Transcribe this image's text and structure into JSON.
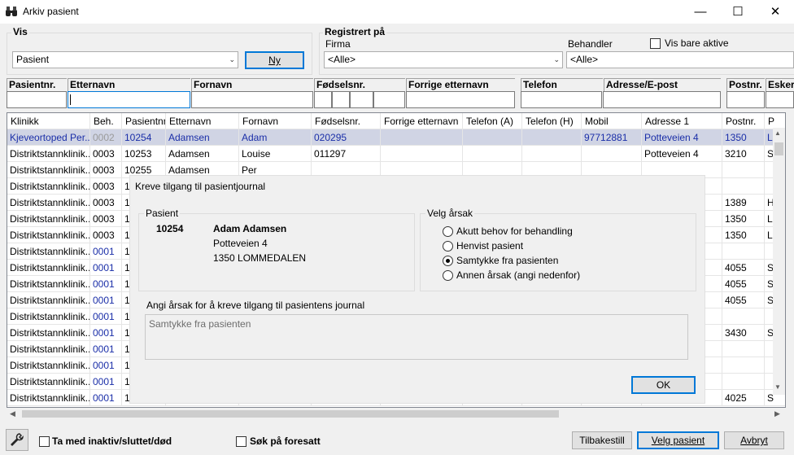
{
  "window": {
    "title": "Arkiv pasient",
    "minimize_icon": "minimize-icon",
    "maximize_icon": "maximize-icon",
    "close_icon": "close-icon"
  },
  "vis": {
    "label": "Vis",
    "selected": "Pasient",
    "ny_button": "Ny"
  },
  "registrert": {
    "label": "Registrert på",
    "firma_label": "Firma",
    "firma_selected": "<Alle>",
    "behandler_label": "Behandler",
    "behandler_selected": "<Alle>",
    "vis_bare_aktive": "Vis bare aktive"
  },
  "filters": {
    "pasientnr": "Pasientnr.",
    "etternavn": "Etternavn",
    "fornavn": "Fornavn",
    "fodselsnr": "Fødselsnr.",
    "forrige_etternavn": "Forrige etternavn",
    "telefon": "Telefon",
    "adresse": "Adresse/E-post",
    "postnr": "Postnr.",
    "esker": "Esker"
  },
  "grid": {
    "columns": [
      "Klinikk",
      "Beh.",
      "Pasientnr.",
      "Etternavn",
      "Fornavn",
      "Fødselsnr.",
      "Forrige etternavn",
      "Telefon (A)",
      "Telefon (H)",
      "Mobil",
      "Adresse 1",
      "Postnr.",
      "P"
    ],
    "rows": [
      {
        "klinikk": "Kjeveortoped Per...",
        "beh": "0002",
        "pasientnr": "10254",
        "etternavn": "Adamsen",
        "fornavn": "Adam",
        "fodselsnr": "020295",
        "mobil": "97712881",
        "adresse": "Potteveien 4",
        "postnr": "1350",
        "p": "L"
      },
      {
        "klinikk": "Distriktstannklinik...",
        "beh": "0003",
        "pasientnr": "10253",
        "etternavn": "Adamsen",
        "fornavn": "Louise",
        "fodselsnr": "011297",
        "mobil": "",
        "adresse": "Potteveien 4",
        "postnr": "3210",
        "p": "S"
      },
      {
        "klinikk": "Distriktstannklinik...",
        "beh": "0003",
        "pasientnr": "10255",
        "etternavn": "Adamsen",
        "fornavn": "Per",
        "fodselsnr": "",
        "mobil": "",
        "adresse": "",
        "postnr": "",
        "p": ""
      },
      {
        "klinikk": "Distriktstannklinik...",
        "beh": "0003",
        "pasientnr": "1",
        "postnr": "",
        "p": ""
      },
      {
        "klinikk": "Distriktstannklinik...",
        "beh": "0003",
        "pasientnr": "1",
        "postnr": "1389",
        "p": "H"
      },
      {
        "klinikk": "Distriktstannklinik...",
        "beh": "0003",
        "pasientnr": "1",
        "postnr": "1350",
        "p": "L"
      },
      {
        "klinikk": "Distriktstannklinik...",
        "beh": "0003",
        "pasientnr": "1",
        "postnr": "1350",
        "p": "L"
      },
      {
        "klinikk": "Distriktstannklinik...",
        "beh": "0001",
        "pasientnr": "1",
        "postnr": "",
        "p": ""
      },
      {
        "klinikk": "Distriktstannklinik...",
        "beh": "0001",
        "pasientnr": "1",
        "postnr": "4055",
        "p": "S"
      },
      {
        "klinikk": "Distriktstannklinik...",
        "beh": "0001",
        "pasientnr": "1",
        "postnr": "4055",
        "p": "S"
      },
      {
        "klinikk": "Distriktstannklinik...",
        "beh": "0001",
        "pasientnr": "1",
        "postnr": "4055",
        "p": "S"
      },
      {
        "klinikk": "Distriktstannklinik...",
        "beh": "0001",
        "pasientnr": "1",
        "postnr": "",
        "p": ""
      },
      {
        "klinikk": "Distriktstannklinik...",
        "beh": "0001",
        "pasientnr": "1",
        "postnr": "3430",
        "p": "S"
      },
      {
        "klinikk": "Distriktstannklinik...",
        "beh": "0001",
        "pasientnr": "1",
        "postnr": "",
        "p": ""
      },
      {
        "klinikk": "Distriktstannklinik...",
        "beh": "0001",
        "pasientnr": "1",
        "postnr": "",
        "p": ""
      },
      {
        "klinikk": "Distriktstannklinik...",
        "beh": "0001",
        "pasientnr": "1",
        "postnr": "",
        "p": ""
      },
      {
        "klinikk": "Distriktstannklinik...",
        "beh": "0001",
        "pasientnr": "1",
        "postnr": "4025",
        "p": "S"
      }
    ]
  },
  "modal": {
    "title": "Kreve tilgang til pasientjournal",
    "pasient_label": "Pasient",
    "pasient_nr": "10254",
    "pasient_name": "Adam Adamsen",
    "pasient_address": "Potteveien 4",
    "pasient_city": "1350 LOMMEDALEN",
    "velg_label": "Velg årsak",
    "options": [
      "Akutt behov for behandling",
      "Henvist pasient",
      "Samtykke fra pasienten",
      "Annen årsak (angi nedenfor)"
    ],
    "selected_option": "Samtykke fra pasienten",
    "angi_label": "Angi årsak for å kreve tilgang til pasientens journal",
    "angi_value": "Samtykke fra pasienten",
    "ok_button": "OK"
  },
  "bottom": {
    "inaktiv": "Ta med inaktiv/sluttet/død",
    "foresatt": "Søk på foresatt",
    "tilbakestill": "Tilbakestill",
    "velg_pasient": "Velg pasient",
    "avbryt": "Avbryt"
  }
}
